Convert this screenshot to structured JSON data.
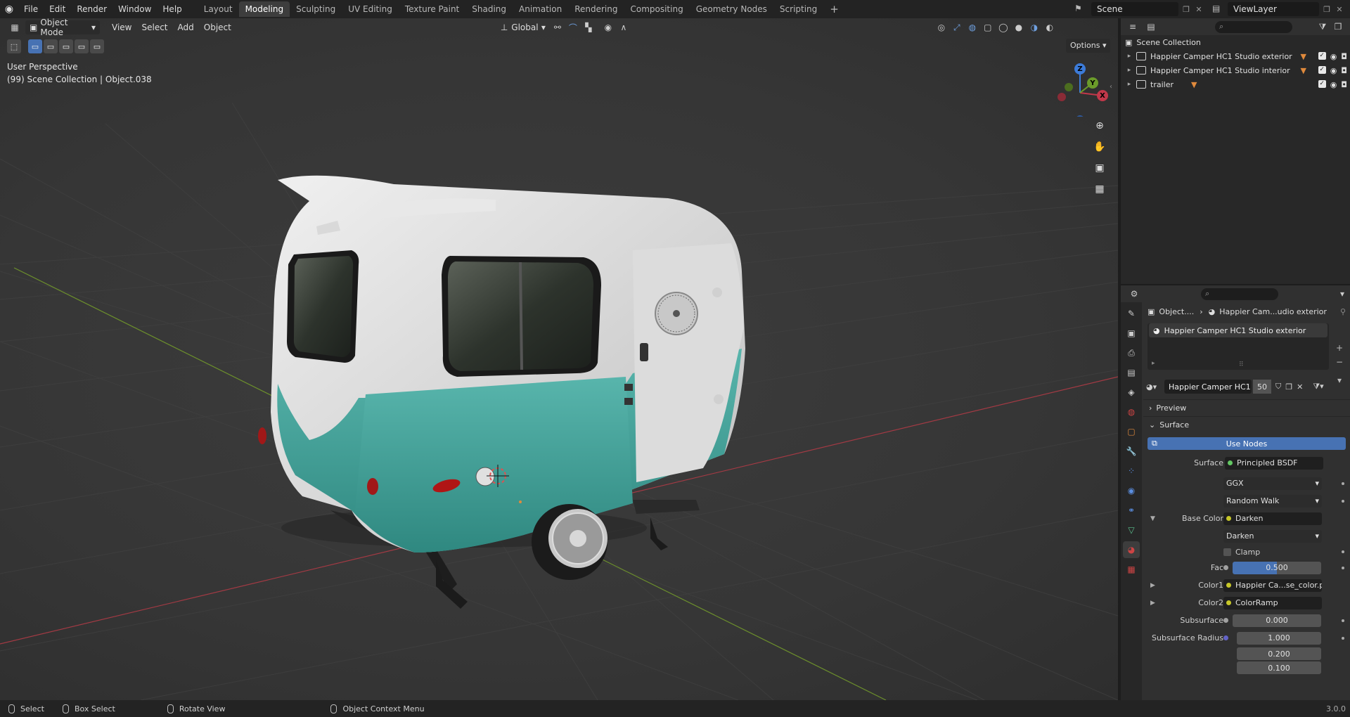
{
  "menubar": {
    "items": [
      "File",
      "Edit",
      "Render",
      "Window",
      "Help"
    ],
    "workspaces": [
      "Layout",
      "Modeling",
      "Sculpting",
      "UV Editing",
      "Texture Paint",
      "Shading",
      "Animation",
      "Rendering",
      "Compositing",
      "Geometry Nodes",
      "Scripting"
    ],
    "active_workspace": "Modeling",
    "add_tab": "+",
    "scene": "Scene",
    "view_layer": "ViewLayer"
  },
  "viewport": {
    "mode": "Object Mode",
    "menus": [
      "View",
      "Select",
      "Add",
      "Object"
    ],
    "orientation": "Global",
    "options": "Options",
    "info_line1": "User Perspective",
    "info_line2": "(99) Scene Collection | Object.038",
    "gizmo_labels": {
      "z": "Z",
      "y": "Y",
      "x": "X"
    }
  },
  "outliner": {
    "root": "Scene Collection",
    "search_placeholder": "",
    "rows": [
      {
        "label": "Happier Camper HC1 Studio  exterior"
      },
      {
        "label": "Happier Camper HC1 Studio  interior"
      },
      {
        "label": "trailer"
      }
    ]
  },
  "properties": {
    "breadcrumb_object": "Object....",
    "breadcrumb_material": "Happier Cam...udio  exterior",
    "slot_name": "Happier Camper HC1 Studio  exterior",
    "material_name": "Happier Camper HC1 ...",
    "material_users": "50",
    "sections": {
      "preview": "Preview",
      "surface": "Surface"
    },
    "use_nodes": "Use Nodes",
    "fields": [
      {
        "label": "Surface",
        "value": "Principled BSDF",
        "socket": "green",
        "kind": "link"
      },
      {
        "label": "",
        "value": "GGX",
        "kind": "drop"
      },
      {
        "label": "",
        "value": "Random Walk",
        "kind": "drop"
      },
      {
        "label": "Base Color",
        "value": "Darken",
        "socket": "yellow",
        "kind": "link",
        "expanded": true
      },
      {
        "label": "",
        "value": "Darken",
        "kind": "drop"
      },
      {
        "label": "",
        "value": "Clamp",
        "kind": "check"
      },
      {
        "label": "Fac",
        "value": "0.500",
        "socket": "grey",
        "kind": "slider",
        "fraction": 0.5
      },
      {
        "label": "Color1",
        "value": "Happier Ca...se_color.png",
        "socket": "yellow",
        "kind": "link",
        "collapsed": true
      },
      {
        "label": "Color2",
        "value": "ColorRamp",
        "socket": "yellow",
        "kind": "link",
        "collapsed": true
      },
      {
        "label": "Subsurface",
        "value": "0.000",
        "socket": "grey",
        "kind": "num"
      },
      {
        "label": "Subsurface Radius",
        "value": "1.000",
        "socket": "blue",
        "kind": "num"
      },
      {
        "label": "",
        "value": "0.200",
        "kind": "num"
      },
      {
        "label": "",
        "value": "0.100",
        "kind": "num"
      }
    ]
  },
  "statusbar": {
    "select": "Select",
    "box_select": "Box Select",
    "rotate_view": "Rotate View",
    "context_menu": "Object Context Menu",
    "version": "3.0.0"
  }
}
